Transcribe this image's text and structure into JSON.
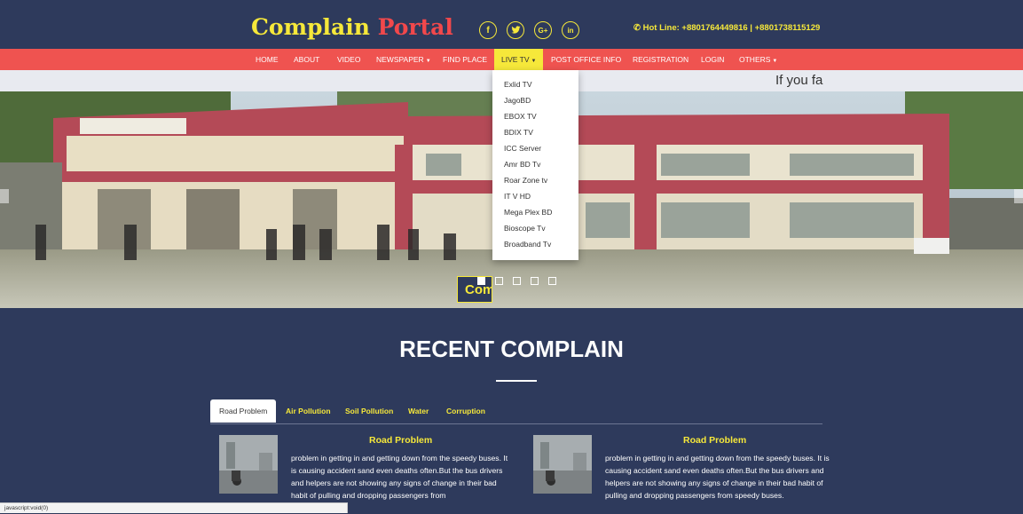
{
  "header": {
    "brand_part1": "Complain",
    "brand_part2": "Portal",
    "social": [
      {
        "icon": "facebook-icon",
        "glyph": "f"
      },
      {
        "icon": "twitter-icon",
        "glyph": "🐦"
      },
      {
        "icon": "google-plus-icon",
        "glyph": "G+"
      },
      {
        "icon": "linkedin-icon",
        "glyph": "in"
      }
    ],
    "hotline_icon": "phone-icon",
    "hotline": "Hot Line: +8801764449816 | +8801738115129"
  },
  "nav": {
    "items": [
      "HOME",
      "ABOUT",
      "VIDEO",
      "NEWSPAPER",
      "FIND PLACE",
      "LIVE TV",
      "POST OFFICE INFO",
      "REGISTRATION",
      "LOGIN",
      "OTHERS"
    ],
    "active": "LIVE TV",
    "caret": "▼"
  },
  "marquee": "If you fa",
  "slider": {
    "caption": "Com",
    "indicator_count": 5,
    "active_indicator": 1
  },
  "live_tv_menu": [
    "Exlid TV",
    "JagoBD",
    "EBOX TV",
    "BDIX TV",
    "ICC Server",
    "Amr BD Tv",
    "Roar Zone tv",
    "IT V HD",
    "Mega Plex BD",
    "Bioscope Tv",
    "Broadband Tv"
  ],
  "recent": {
    "title": "RECENT COMPLAIN",
    "tabs": [
      "Road Problem",
      "Air Pollution",
      "Soil Pollution",
      "Water",
      "Corruption"
    ],
    "active_tab": "Road Problem",
    "cards": [
      {
        "title": "Road Problem",
        "text": "problem in getting in and getting down from the speedy buses. It is causing accident sand even deaths often.But the bus drivers and helpers are not showing any signs of change in their bad habit of pulling and dropping passengers from"
      },
      {
        "title": "Road Problem",
        "text": "problem in getting in and getting down from the speedy buses. It is causing accident sand even deaths often.But the bus drivers and helpers are not showing any signs of change in their bad habit of pulling and dropping passengers from speedy buses."
      }
    ]
  },
  "statusbar": "javascript:void(0)",
  "colors": {
    "navy": "#2e3a5c",
    "yellow": "#f6e83a",
    "red": "#ef5350"
  }
}
